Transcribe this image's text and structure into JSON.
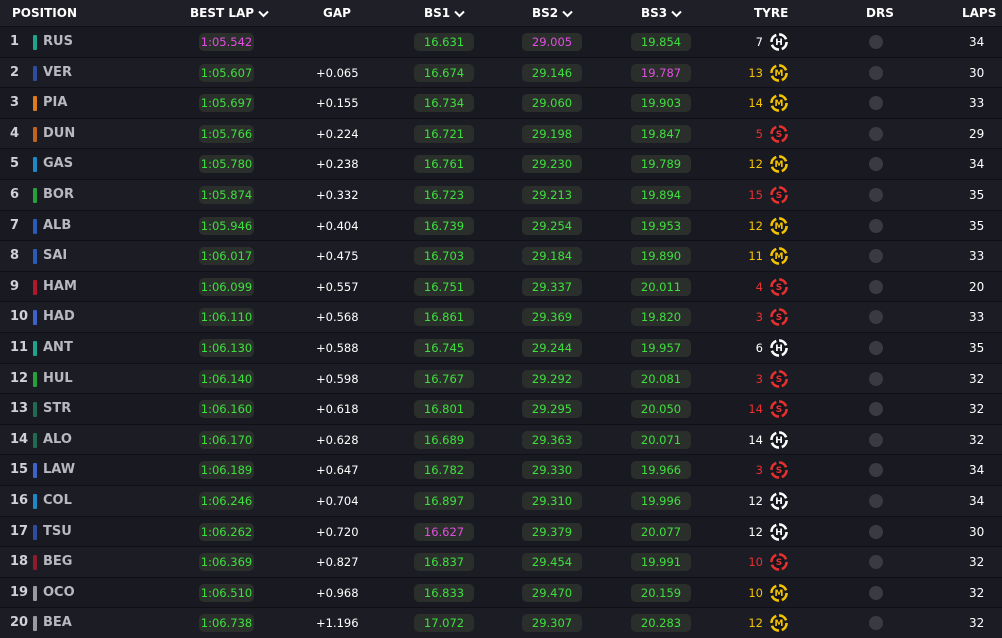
{
  "colors": {
    "soft": "#e8312f",
    "medium": "#f5c400",
    "hard": "#ffffff",
    "personal_best": "#3ee03e",
    "overall_best": "#e14ee1"
  },
  "header": {
    "position": "POSITION",
    "best_lap": "BEST LAP",
    "gap": "GAP",
    "bs1": "BS1",
    "bs2": "BS2",
    "bs3": "BS3",
    "tyre": "TYRE",
    "drs": "DRS",
    "laps": "LAPS"
  },
  "rows": [
    {
      "pos": "1",
      "code": "RUS",
      "team_color": "#1fa38a",
      "best_lap": "1:05.542",
      "lap_best": true,
      "gap": "",
      "bs1": "16.631",
      "bs1_best": false,
      "bs2": "29.005",
      "bs2_best": true,
      "bs3": "19.854",
      "bs3_best": false,
      "tyre_age": "7",
      "tyre": "H",
      "laps": "34"
    },
    {
      "pos": "2",
      "code": "VER",
      "team_color": "#2f4d9e",
      "best_lap": "1:05.607",
      "lap_best": false,
      "gap": "+0.065",
      "bs1": "16.674",
      "bs1_best": false,
      "bs2": "29.146",
      "bs2_best": false,
      "bs3": "19.787",
      "bs3_best": true,
      "tyre_age": "13",
      "tyre": "M",
      "laps": "30"
    },
    {
      "pos": "3",
      "code": "PIA",
      "team_color": "#e07b1b",
      "best_lap": "1:05.697",
      "lap_best": false,
      "gap": "+0.155",
      "bs1": "16.734",
      "bs1_best": false,
      "bs2": "29.060",
      "bs2_best": false,
      "bs3": "19.903",
      "bs3_best": false,
      "tyre_age": "14",
      "tyre": "M",
      "laps": "33"
    },
    {
      "pos": "4",
      "code": "DUN",
      "team_color": "#c0641d",
      "best_lap": "1:05.766",
      "lap_best": false,
      "gap": "+0.224",
      "bs1": "16.721",
      "bs1_best": false,
      "bs2": "29.198",
      "bs2_best": false,
      "bs3": "19.847",
      "bs3_best": false,
      "tyre_age": "5",
      "tyre": "S",
      "laps": "29"
    },
    {
      "pos": "5",
      "code": "GAS",
      "team_color": "#1e88c7",
      "best_lap": "1:05.780",
      "lap_best": false,
      "gap": "+0.238",
      "bs1": "16.761",
      "bs1_best": false,
      "bs2": "29.230",
      "bs2_best": false,
      "bs3": "19.789",
      "bs3_best": false,
      "tyre_age": "12",
      "tyre": "M",
      "laps": "34"
    },
    {
      "pos": "6",
      "code": "BOR",
      "team_color": "#25a03a",
      "best_lap": "1:05.874",
      "lap_best": false,
      "gap": "+0.332",
      "bs1": "16.723",
      "bs1_best": false,
      "bs2": "29.213",
      "bs2_best": false,
      "bs3": "19.894",
      "bs3_best": false,
      "tyre_age": "15",
      "tyre": "S",
      "laps": "35"
    },
    {
      "pos": "7",
      "code": "ALB",
      "team_color": "#2a5bb8",
      "best_lap": "1:05.946",
      "lap_best": false,
      "gap": "+0.404",
      "bs1": "16.739",
      "bs1_best": false,
      "bs2": "29.254",
      "bs2_best": false,
      "bs3": "19.953",
      "bs3_best": false,
      "tyre_age": "12",
      "tyre": "M",
      "laps": "35"
    },
    {
      "pos": "8",
      "code": "SAI",
      "team_color": "#2a5bb8",
      "best_lap": "1:06.017",
      "lap_best": false,
      "gap": "+0.475",
      "bs1": "16.703",
      "bs1_best": false,
      "bs2": "29.184",
      "bs2_best": false,
      "bs3": "19.890",
      "bs3_best": false,
      "tyre_age": "11",
      "tyre": "M",
      "laps": "33"
    },
    {
      "pos": "9",
      "code": "HAM",
      "team_color": "#b2182b",
      "best_lap": "1:06.099",
      "lap_best": false,
      "gap": "+0.557",
      "bs1": "16.751",
      "bs1_best": false,
      "bs2": "29.337",
      "bs2_best": false,
      "bs3": "20.011",
      "bs3_best": false,
      "tyre_age": "4",
      "tyre": "S",
      "laps": "20"
    },
    {
      "pos": "10",
      "code": "HAD",
      "team_color": "#3d63c9",
      "best_lap": "1:06.110",
      "lap_best": false,
      "gap": "+0.568",
      "bs1": "16.861",
      "bs1_best": false,
      "bs2": "29.369",
      "bs2_best": false,
      "bs3": "19.820",
      "bs3_best": false,
      "tyre_age": "3",
      "tyre": "S",
      "laps": "33"
    },
    {
      "pos": "11",
      "code": "ANT",
      "team_color": "#1fa38a",
      "best_lap": "1:06.130",
      "lap_best": false,
      "gap": "+0.588",
      "bs1": "16.745",
      "bs1_best": false,
      "bs2": "29.244",
      "bs2_best": false,
      "bs3": "19.957",
      "bs3_best": false,
      "tyre_age": "6",
      "tyre": "H",
      "laps": "35"
    },
    {
      "pos": "12",
      "code": "HUL",
      "team_color": "#25a03a",
      "best_lap": "1:06.140",
      "lap_best": false,
      "gap": "+0.598",
      "bs1": "16.767",
      "bs1_best": false,
      "bs2": "29.292",
      "bs2_best": false,
      "bs3": "20.081",
      "bs3_best": false,
      "tyre_age": "3",
      "tyre": "S",
      "laps": "32"
    },
    {
      "pos": "13",
      "code": "STR",
      "team_color": "#1e6b4f",
      "best_lap": "1:06.160",
      "lap_best": false,
      "gap": "+0.618",
      "bs1": "16.801",
      "bs1_best": false,
      "bs2": "29.295",
      "bs2_best": false,
      "bs3": "20.050",
      "bs3_best": false,
      "tyre_age": "14",
      "tyre": "S",
      "laps": "32"
    },
    {
      "pos": "14",
      "code": "ALO",
      "team_color": "#1e6b4f",
      "best_lap": "1:06.170",
      "lap_best": false,
      "gap": "+0.628",
      "bs1": "16.689",
      "bs1_best": false,
      "bs2": "29.363",
      "bs2_best": false,
      "bs3": "20.071",
      "bs3_best": false,
      "tyre_age": "14",
      "tyre": "H",
      "laps": "32"
    },
    {
      "pos": "15",
      "code": "LAW",
      "team_color": "#3d63c9",
      "best_lap": "1:06.189",
      "lap_best": false,
      "gap": "+0.647",
      "bs1": "16.782",
      "bs1_best": false,
      "bs2": "29.330",
      "bs2_best": false,
      "bs3": "19.966",
      "bs3_best": false,
      "tyre_age": "3",
      "tyre": "S",
      "laps": "34"
    },
    {
      "pos": "16",
      "code": "COL",
      "team_color": "#1e88c7",
      "best_lap": "1:06.246",
      "lap_best": false,
      "gap": "+0.704",
      "bs1": "16.897",
      "bs1_best": false,
      "bs2": "29.310",
      "bs2_best": false,
      "bs3": "19.996",
      "bs3_best": false,
      "tyre_age": "12",
      "tyre": "H",
      "laps": "34"
    },
    {
      "pos": "17",
      "code": "TSU",
      "team_color": "#2f4d9e",
      "best_lap": "1:06.262",
      "lap_best": false,
      "gap": "+0.720",
      "bs1": "16.627",
      "bs1_best": true,
      "bs2": "29.379",
      "bs2_best": false,
      "bs3": "20.077",
      "bs3_best": false,
      "tyre_age": "12",
      "tyre": "H",
      "laps": "30"
    },
    {
      "pos": "18",
      "code": "BEG",
      "team_color": "#8a1c2b",
      "best_lap": "1:06.369",
      "lap_best": false,
      "gap": "+0.827",
      "bs1": "16.837",
      "bs1_best": false,
      "bs2": "29.454",
      "bs2_best": false,
      "bs3": "19.991",
      "bs3_best": false,
      "tyre_age": "10",
      "tyre": "S",
      "laps": "32"
    },
    {
      "pos": "19",
      "code": "OCO",
      "team_color": "#9a9aa2",
      "best_lap": "1:06.510",
      "lap_best": false,
      "gap": "+0.968",
      "bs1": "16.833",
      "bs1_best": false,
      "bs2": "29.470",
      "bs2_best": false,
      "bs3": "20.159",
      "bs3_best": false,
      "tyre_age": "10",
      "tyre": "M",
      "laps": "32"
    },
    {
      "pos": "20",
      "code": "BEA",
      "team_color": "#9a9aa2",
      "best_lap": "1:06.738",
      "lap_best": false,
      "gap": "+1.196",
      "bs1": "17.072",
      "bs1_best": false,
      "bs2": "29.307",
      "bs2_best": false,
      "bs3": "20.283",
      "bs3_best": false,
      "tyre_age": "12",
      "tyre": "M",
      "laps": "32"
    }
  ]
}
